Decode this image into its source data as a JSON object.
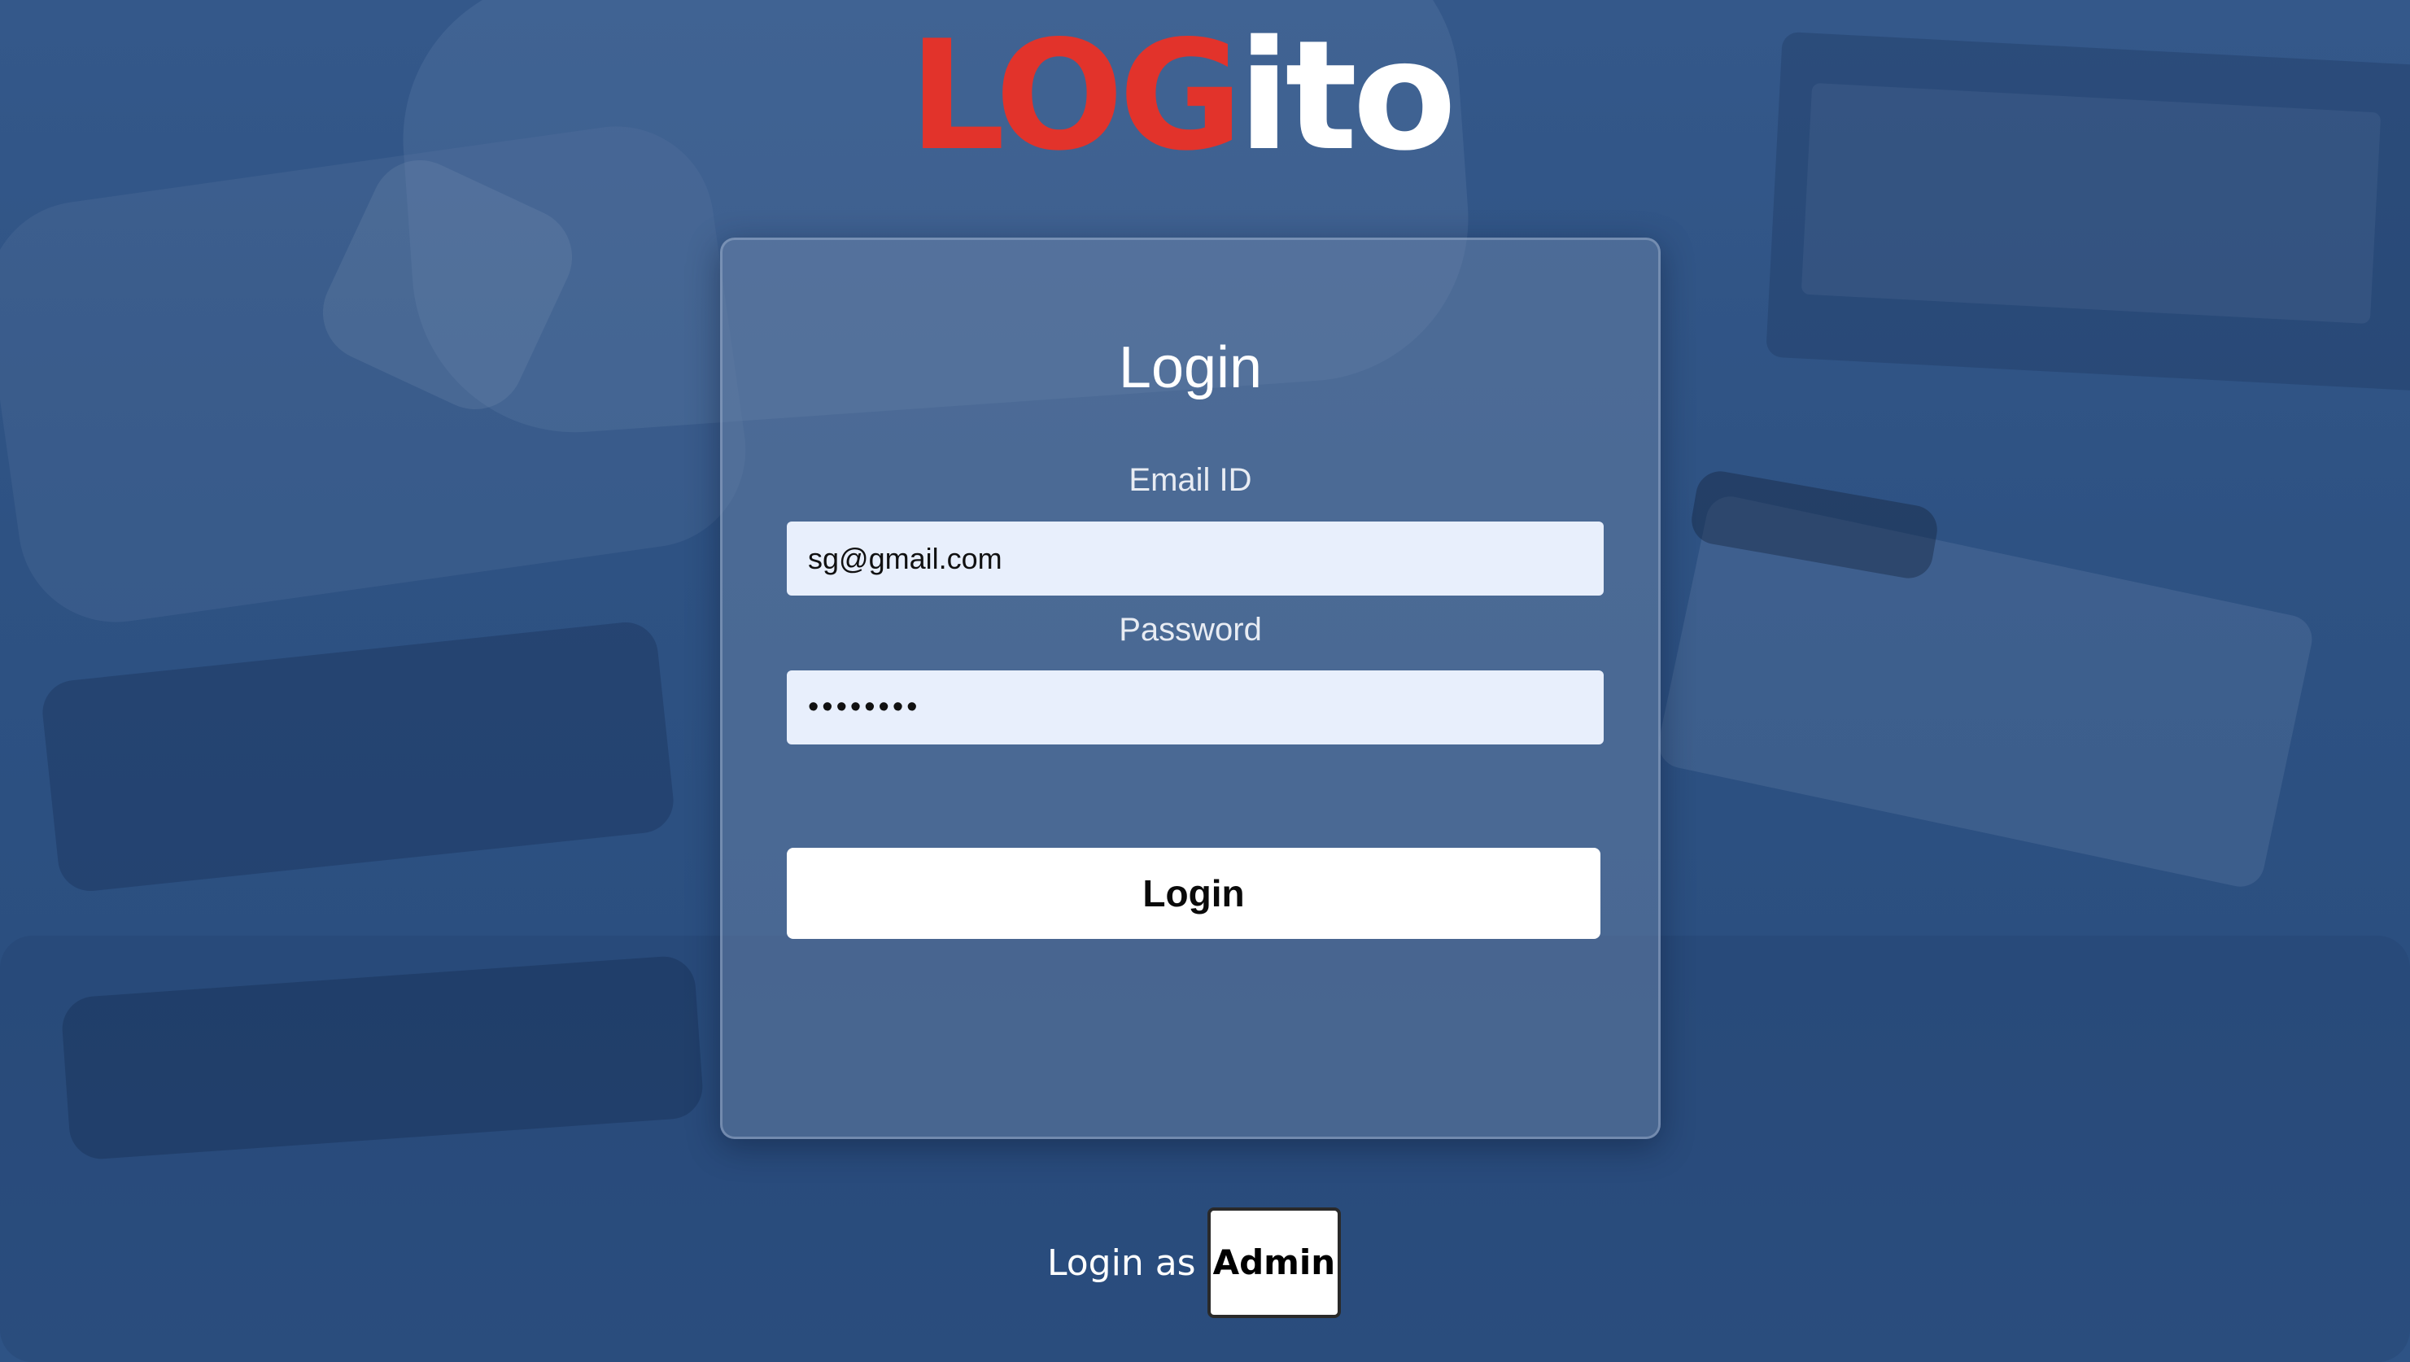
{
  "logo": {
    "part_red": "LOG",
    "part_white": "ito",
    "red_color": "#e2332b"
  },
  "login_card": {
    "title": "Login",
    "email_label": "Email ID",
    "email_value": "sg@gmail.com",
    "password_label": "Password",
    "password_value": "••••••••",
    "login_button": "Login"
  },
  "footer": {
    "login_as_text": "Login as",
    "admin_button": "Admin"
  }
}
